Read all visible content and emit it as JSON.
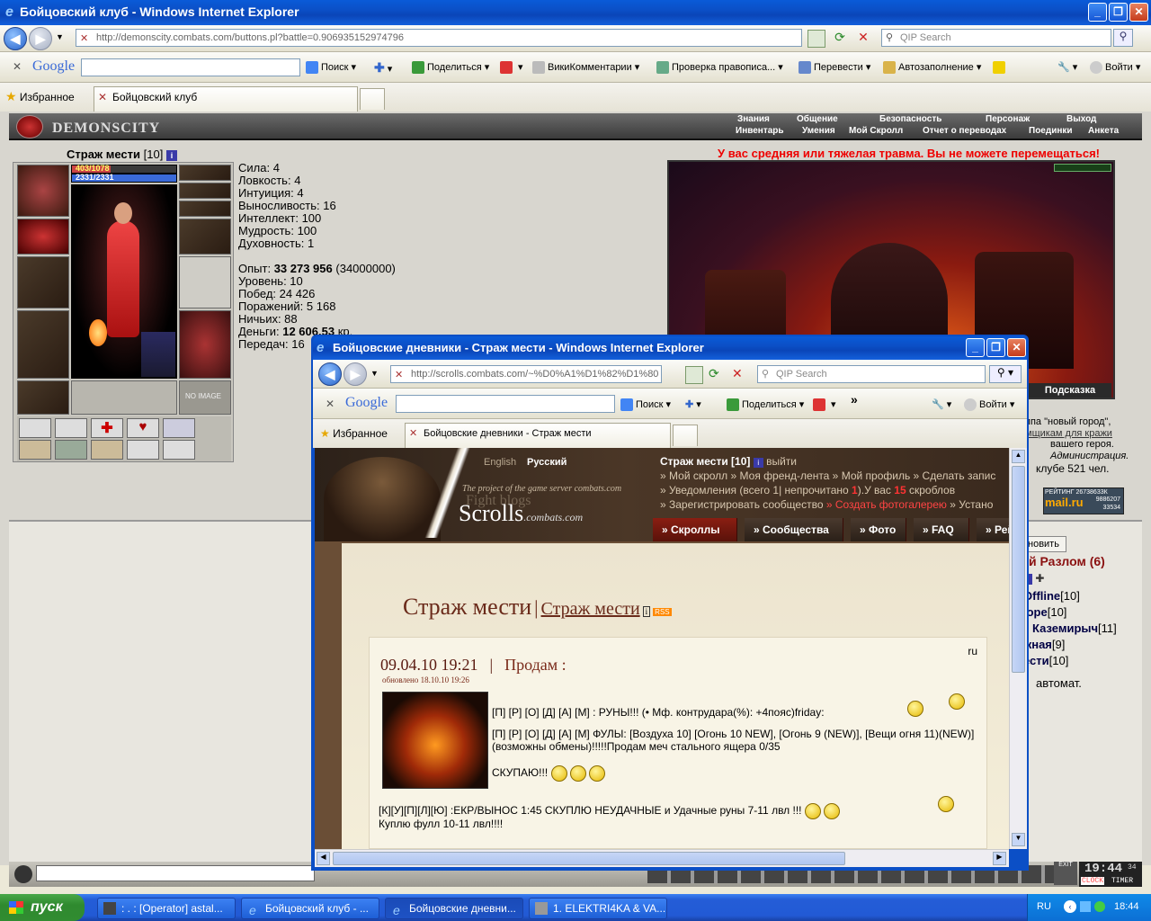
{
  "main_window": {
    "title": "Бойцовский клуб - Windows Internet Explorer",
    "address": "http://demonscity.combats.com/buttons.pl?battle=0.906935152974796",
    "address_host": "combats.com",
    "search_placeholder": "QIP Search",
    "google_label": "Google",
    "toolbar": {
      "search": "Поиск",
      "share": "Поделиться",
      "wiki": "ВикиКомментарии",
      "spell": "Проверка правописа...",
      "translate": "Перевести",
      "autofill": "Автозаполнение",
      "login": "Войти"
    },
    "favorites": "Избранное",
    "tab_title": "Бойцовский клуб"
  },
  "game": {
    "logo": "DEMONSCITY",
    "menu_top": [
      "Знания",
      "Общение",
      "Безопасность",
      "Персонаж",
      "Выход"
    ],
    "menu_bottom": [
      "Инвентарь",
      "Умения",
      "Мой Скролл",
      "Отчет о переводах",
      "Поединки",
      "Анкета"
    ],
    "char_name": "Страж мести",
    "char_level": "[10]",
    "hp": "403/1078",
    "mana": "2331/2331",
    "no_image": "NO IMAGE",
    "stats": [
      {
        "label": "Сила:",
        "value": "4"
      },
      {
        "label": "Ловкость:",
        "value": "4"
      },
      {
        "label": "Интуиция:",
        "value": "4"
      },
      {
        "label": "Выносливость:",
        "value": "16"
      },
      {
        "label": "Интеллект:",
        "value": "100"
      },
      {
        "label": "Мудрость:",
        "value": "100"
      },
      {
        "label": "Духовность:",
        "value": "1"
      }
    ],
    "exp_label": "Опыт:",
    "exp_value": "33 273 956",
    "exp_next": "(34000000)",
    "level_line": "Уровень: 10",
    "wins_line": "Побед: 24 426",
    "losses_line": "Поражений: 5 168",
    "draws_line": "Ничьих: 88",
    "money_label": "Деньги:",
    "money_value": "12 606.53",
    "money_unit": "кр.",
    "transfers_line": "Передач: 16",
    "injury_warning": "У вас средняя или тяжелая травма. Вы не можете перемещаться!",
    "hint_label": "Подсказка",
    "news_lines": [
      "ппа \"новый город\",",
      "мщикам для кражи",
      "вашего героя.",
      "Администрация."
    ],
    "online_text": "клубе 521 чел.",
    "rating_label": "РЕЙТИНГ 26738633К",
    "rating_site": "mail.ru",
    "rating_nums": [
      "9886207",
      "33534"
    ],
    "refresh_btn": "новить",
    "location": "й Разлом (6)",
    "players": [
      {
        "name": "Offline",
        "level": "[10]"
      },
      {
        "name": "lope",
        "level": "[10]"
      },
      {
        "name": "Каземирыч",
        "level": "[11]"
      },
      {
        "name": "жная",
        "level": "[9]"
      },
      {
        "name": "ести",
        "level": "[10]"
      }
    ],
    "chat_text": "автомат.",
    "clock": "19:44",
    "clock_sec": "34",
    "clock_label": "CLOCK",
    "timer_label": "TIMER",
    "exit_label": "EXIT"
  },
  "popup_window": {
    "title": "Бойцовские дневники - Страж мести - Windows Internet Explorer",
    "address": "http://scrolls.combats.com/~%D0%A1%D1%82%D1%80",
    "search_placeholder": "QIP Search",
    "google_label": "Google",
    "toolbar": {
      "search": "Поиск",
      "share": "Поделиться",
      "login": "Войти",
      "more": "»"
    },
    "favorites": "Избранное",
    "tab_title": "Бойцовские дневники - Страж мести"
  },
  "scrolls": {
    "lang_en": "English",
    "lang_ru": "Русский",
    "tagline": "The project of the game server combats.com",
    "fight_blogs": "Fight blogs",
    "logo": "Scrolls",
    "logo_suffix": ".combats.com",
    "user": "Страж мести [10]",
    "logout": "выйти",
    "links1": "» Мой скролл » Моя френд-лента » Мой профиль » Сделать запис",
    "links2_a": "» Уведомления (всего 1| непрочитано ",
    "links2_b": "1",
    "links2_c": ").У вас ",
    "links2_d": "15",
    "links2_e": " скроблов",
    "links3_a": "» Зарегистрировать сообщество ",
    "links3_b": "» Создать фотогалерею",
    "links3_c": " » Устано",
    "nav": [
      "» Скроллы",
      "» Сообщества",
      "» Фото",
      "» FAQ",
      "» Рей"
    ],
    "blog_title": "Страж мести",
    "blog_sep": "|",
    "blog_owner": "Страж мести",
    "rss": "RSS",
    "lang_tag": "ru",
    "post_date": "09.04.10 19:21",
    "post_sep": "|",
    "post_title": "Продам :",
    "post_updated": "обновлено 18.10.10 19:26",
    "post_line1": "[П] [Р] [О] [Д] [А] [М] : РУНЫ!!! (• Мф. контрудара(%): +4пояс)friday:",
    "post_line2": "[П] [Р] [О] [Д] [А] [М] ФУЛЫ: [Воздуха 10] [Огонь 10 NEW], [Огонь 9 (NEW)], [Вещи огня 11)(NEW)] (возможны обмены)!!!!!Продам меч стального ящера 0/35",
    "post_line3": "СКУПАЮ!!!",
    "post_line4": "[К][У][П][Л][Ю] :ЕКР/ВЫНОС 1:45 СКУПЛЮ НЕУДАЧНЫЕ и Удачные руны 7-11 лвл !!!",
    "post_line5": "Куплю фулл 10-11 лвл!!!!"
  },
  "taskbar": {
    "start": "пуск",
    "tasks": [
      "[Operator] astal...",
      "Бойцовский клуб - ...",
      "Бойцовские дневни...",
      "1. ELEKTRI4KA & VA..."
    ],
    "lang": "RU",
    "time": "18:44"
  }
}
